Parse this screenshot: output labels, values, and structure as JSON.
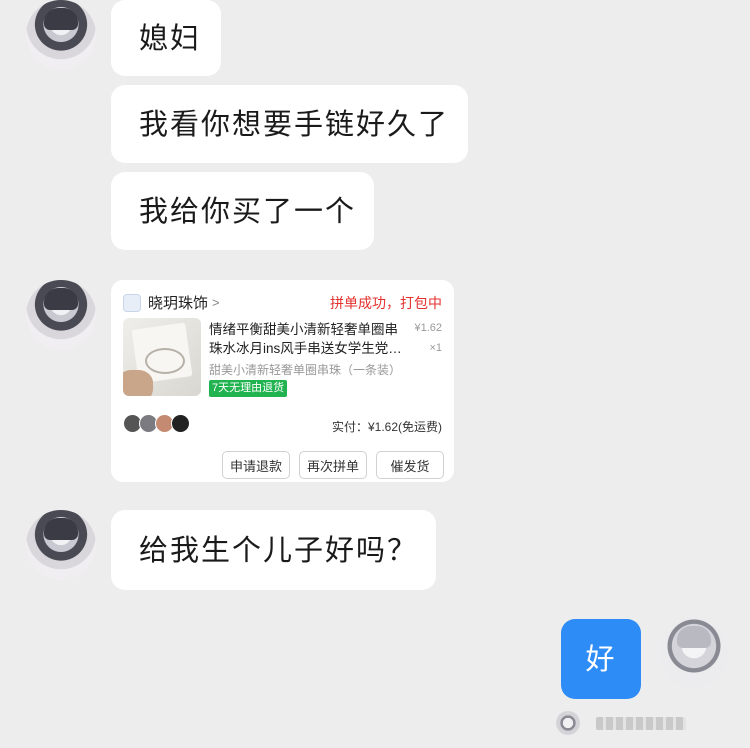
{
  "messages": [
    {
      "text": "媳妇"
    },
    {
      "text": "我看你想要手链好久了"
    },
    {
      "text": "我给你买了一个"
    },
    {
      "text": "给我生个儿子好吗？"
    },
    {
      "text": "好"
    }
  ],
  "order_card": {
    "shop_name": "晓玥珠饰",
    "shop_arrow": ">",
    "status": "拼单成功，打包中",
    "title_line1": "情绪平衡甜美小清新轻奢单圈串",
    "title_line2": "珠水冰月ins风手串送女学生党…",
    "unit_price": "¥1.62",
    "quantity": "×1",
    "spec": "甜美小清新轻奢单圈串珠（一条装）",
    "badge": "7天无理由退货",
    "paid": "实付：¥1.62(免运费)",
    "buttons": [
      "申请退款",
      "再次拼单",
      "催发货"
    ]
  },
  "colors": {
    "background": "#ededed",
    "bubble_incoming": "#ffffff",
    "bubble_outgoing": "#2e8cf7",
    "status_red": "#e5312d",
    "badge_green": "#21b350"
  }
}
